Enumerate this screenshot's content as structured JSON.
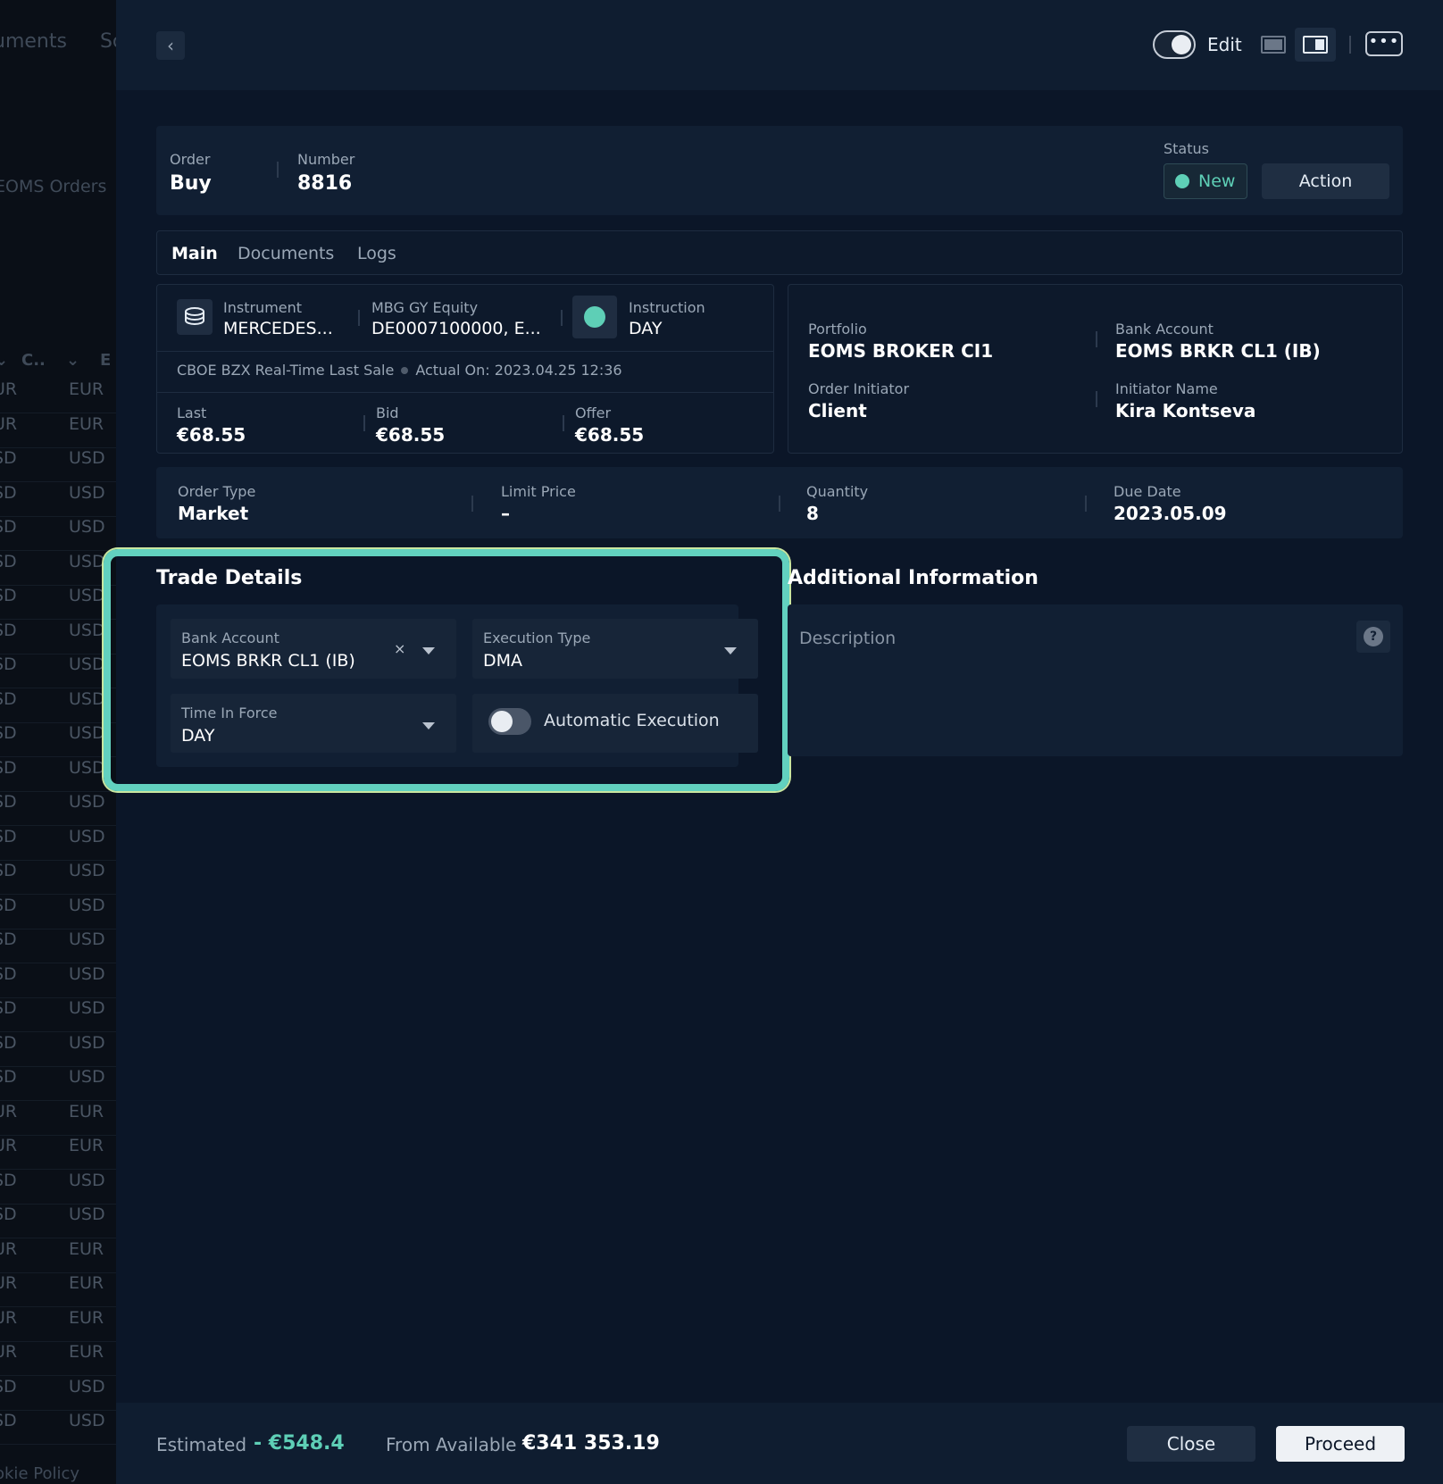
{
  "background": {
    "nav_items": [
      "uments",
      "Sc"
    ],
    "title": "EOMS Orders",
    "headers": [
      "C..",
      "E"
    ],
    "rows": [
      [
        "UR",
        "EUR"
      ],
      [
        "UR",
        "EUR"
      ],
      [
        "SD",
        "USD"
      ],
      [
        "SD",
        "USD"
      ],
      [
        "SD",
        "USD"
      ],
      [
        "SD",
        "USD"
      ],
      [
        "SD",
        "USD"
      ],
      [
        "SD",
        "USD"
      ],
      [
        "SD",
        "USD"
      ],
      [
        "SD",
        "USD"
      ],
      [
        "SD",
        "USD"
      ],
      [
        "SD",
        "USD"
      ],
      [
        "SD",
        "USD"
      ],
      [
        "SD",
        "USD"
      ],
      [
        "SD",
        "USD"
      ],
      [
        "SD",
        "USD"
      ],
      [
        "SD",
        "USD"
      ],
      [
        "SD",
        "USD"
      ],
      [
        "SD",
        "USD"
      ],
      [
        "SD",
        "USD"
      ],
      [
        "SD",
        "USD"
      ],
      [
        "UR",
        "EUR"
      ],
      [
        "UR",
        "EUR"
      ],
      [
        "SD",
        "USD"
      ],
      [
        "SD",
        "USD"
      ],
      [
        "UR",
        "EUR"
      ],
      [
        "UR",
        "EUR"
      ],
      [
        "UR",
        "EUR"
      ],
      [
        "UR",
        "EUR"
      ],
      [
        "SD",
        "USD"
      ],
      [
        "SD",
        "USD"
      ]
    ],
    "footer_link": "okie Policy"
  },
  "topbar": {
    "edit_label": "Edit",
    "more_label": "•••"
  },
  "order": {
    "order_label": "Order",
    "order_value": "Buy",
    "number_label": "Number",
    "number_value": "8816",
    "status_label": "Status",
    "status_value": "New",
    "action_label": "Action"
  },
  "tabs": [
    "Main",
    "Documents",
    "Logs"
  ],
  "instrument": {
    "instrument_label": "Instrument",
    "instrument_value": "MERCEDES...",
    "ticker_label": "MBG GY Equity",
    "ticker_value": "DE0007100000, E...",
    "instruction_label": "Instruction",
    "instruction_value": "DAY",
    "feed_source": "CBOE BZX Real-Time Last Sale",
    "feed_actual": "Actual On: 2023.04.25 12:36",
    "last_label": "Last",
    "last_value": "€68.55",
    "bid_label": "Bid",
    "bid_value": "€68.55",
    "offer_label": "Offer",
    "offer_value": "€68.55"
  },
  "portfolio": {
    "portfolio_label": "Portfolio",
    "portfolio_value": "EOMS BROKER CI1",
    "bank_label": "Bank Account",
    "bank_value": "EOMS BRKR CL1 (IB)",
    "initiator_label": "Order Initiator",
    "initiator_value": "Client",
    "initiator_name_label": "Initiator Name",
    "initiator_name_value": "Kira Kontseva"
  },
  "order_params": {
    "type_label": "Order Type",
    "type_value": "Market",
    "limit_label": "Limit Price",
    "limit_value": "–",
    "qty_label": "Quantity",
    "qty_value": "8",
    "due_label": "Due Date",
    "due_value": "2023.05.09"
  },
  "trade_details": {
    "title": "Trade Details",
    "bank_label": "Bank Account",
    "bank_value": "EOMS BRKR CL1 (IB)",
    "exec_label": "Execution Type",
    "exec_value": "DMA",
    "tif_label": "Time In Force",
    "tif_value": "DAY",
    "auto_label": "Automatic Execution",
    "auto_enabled": false
  },
  "additional": {
    "title": "Additional Information",
    "description_placeholder": "Description",
    "help_glyph": "?"
  },
  "footer": {
    "estimated_label": "Estimated",
    "estimated_value": "- €548.4",
    "available_label": "From Available",
    "available_value": "€341 353.19",
    "close_label": "Close",
    "proceed_label": "Proceed"
  },
  "colors": {
    "accent": "#5ecfb6",
    "highlight": "#62d1bf",
    "panel": "#0b1628"
  }
}
